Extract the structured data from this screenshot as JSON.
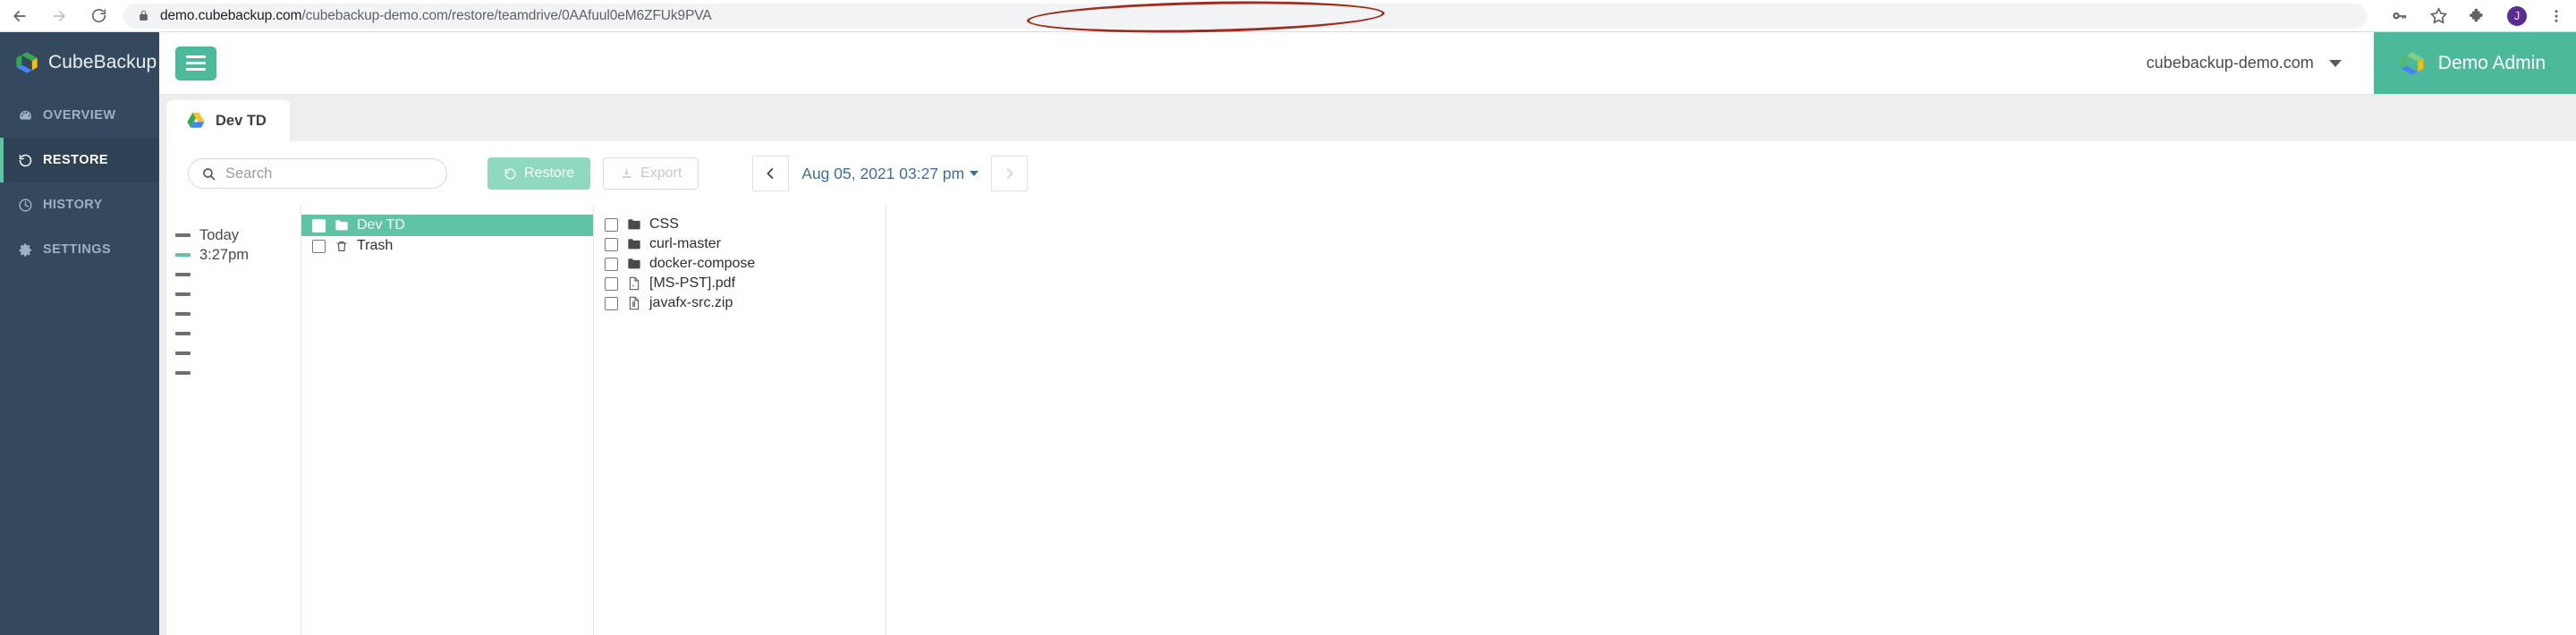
{
  "browser": {
    "back_icon": "back-arrow-icon",
    "forward_icon": "forward-arrow-icon",
    "reload_icon": "reload-icon",
    "lock_icon": "lock-icon",
    "url_host": "demo.cubebackup.com",
    "url_path": "/cubebackup-demo.com/restore/teamdrive/0AAfuul0eM6ZFUk9PVA",
    "key_icon": "key-icon",
    "star_icon": "bookmark-star-icon",
    "extensions_icon": "puzzle-extensions-icon",
    "profile_initial": "J",
    "menu_icon": "three-dot-menu-icon",
    "annotation_color": "#a32a1c"
  },
  "sidebar": {
    "brand": "CubeBackup",
    "accent": "#5ec4a5",
    "background": "#34495e",
    "items": [
      {
        "label": "OVERVIEW",
        "icon": "dashboard-icon",
        "active": false
      },
      {
        "label": "RESTORE",
        "icon": "restore-rotate-icon",
        "active": true
      },
      {
        "label": "HISTORY",
        "icon": "clock-icon",
        "active": false
      },
      {
        "label": "SETTINGS",
        "icon": "gear-icon",
        "active": false
      }
    ]
  },
  "header": {
    "menu_toggle_icon": "hamburger-icon",
    "domain": "cubebackup-demo.com",
    "domain_caret_icon": "chevron-down-icon",
    "user_name": "Demo Admin",
    "user_logo_icon": "cubebackup-logo-icon",
    "accent": "#4db99b"
  },
  "tabs": [
    {
      "label": "Dev TD",
      "icon": "google-drive-icon",
      "active": true
    }
  ],
  "toolbar": {
    "search_placeholder": "Search",
    "search_value": "",
    "search_icon": "search-icon",
    "restore_label": "Restore",
    "restore_icon": "restore-rotate-icon",
    "export_label": "Export",
    "export_icon": "download-export-icon",
    "export_disabled": true,
    "prev_icon": "chevron-left-icon",
    "next_icon": "chevron-right-icon",
    "date_label": "Aug 05, 2021 03:27 pm",
    "date_caret_icon": "chevron-down-icon",
    "date_color": "#3a6ea5"
  },
  "timeline": {
    "day_label": "Today",
    "time_label": "3:27pm",
    "ticks_before": 1,
    "ticks_after": 6,
    "current_tick_color": "#5ec4a5"
  },
  "columns": [
    {
      "name": "root-column",
      "items": [
        {
          "label": "Dev TD",
          "icon": "folder-icon",
          "selected": true,
          "checked": false
        },
        {
          "label": "Trash",
          "icon": "trash-icon",
          "selected": false,
          "checked": false
        }
      ]
    },
    {
      "name": "devtd-column",
      "items": [
        {
          "label": "CSS",
          "icon": "folder-icon",
          "selected": false,
          "checked": false
        },
        {
          "label": "curl-master",
          "icon": "folder-icon",
          "selected": false,
          "checked": false
        },
        {
          "label": "docker-compose",
          "icon": "folder-icon",
          "selected": false,
          "checked": false
        },
        {
          "label": "[MS-PST].pdf",
          "icon": "pdf-file-icon",
          "selected": false,
          "checked": false
        },
        {
          "label": "javafx-src.zip",
          "icon": "zip-file-icon",
          "selected": false,
          "checked": false
        }
      ]
    },
    {
      "name": "detail-column",
      "items": []
    }
  ]
}
